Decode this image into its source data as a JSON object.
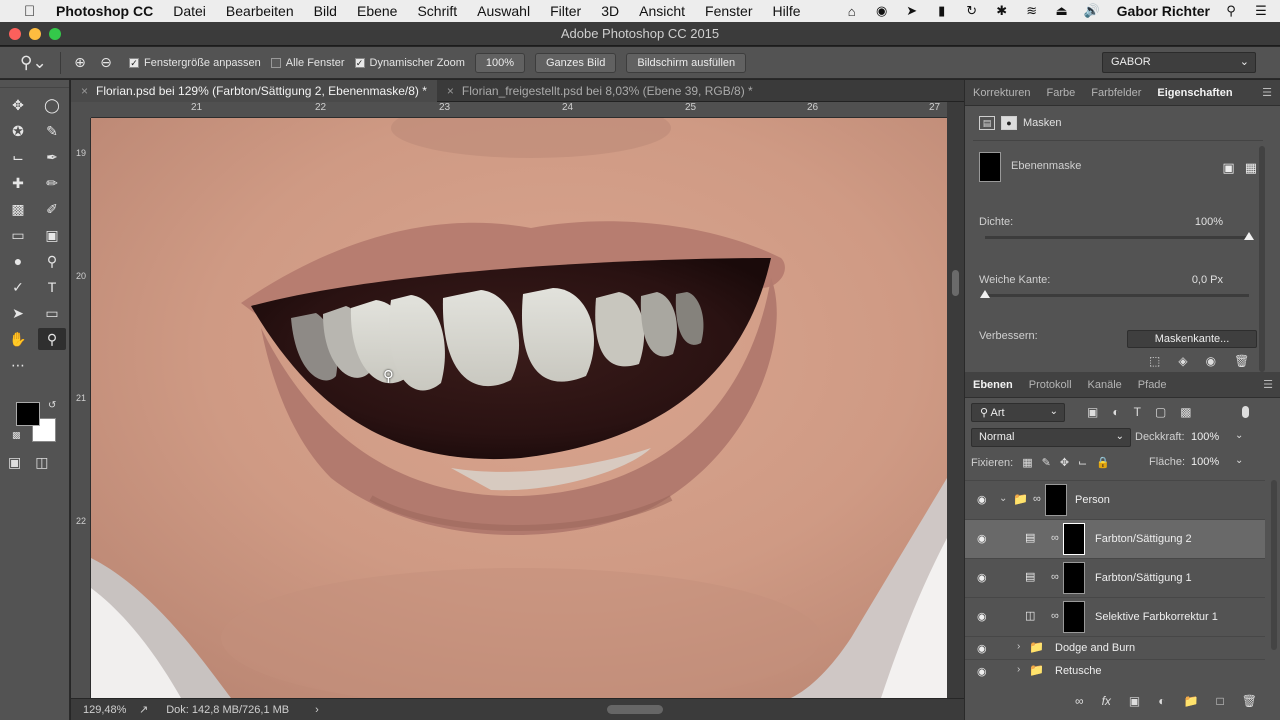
{
  "menubar": {
    "apple": "",
    "items": [
      "Photoshop CC",
      "Datei",
      "Bearbeiten",
      "Bild",
      "Ebene",
      "Schrift",
      "Auswahl",
      "Filter",
      "3D",
      "Ansicht",
      "Fenster",
      "Hilfe"
    ],
    "user": "Gabor Richter"
  },
  "window": {
    "title": "Adobe Photoshop CC 2015"
  },
  "options": {
    "fit_window": "Fenstergröße anpassen",
    "all_windows": "Alle Fenster",
    "dynamic_zoom": "Dynamischer Zoom",
    "zoom_100": "100%",
    "fit_screen": "Ganzes Bild",
    "fill_screen": "Bildschirm ausfüllen",
    "workspace": "GABOR"
  },
  "tabs": [
    {
      "label": "Florian.psd bei 129% (Farbton/Sättigung 2, Ebenenmaske/8) *"
    },
    {
      "label": "Florian_freigestellt.psd bei 8,03% (Ebene 39, RGB/8) *"
    }
  ],
  "ruler": {
    "h": [
      "21",
      "22",
      "23",
      "24",
      "25",
      "26",
      "27"
    ],
    "v": [
      "19",
      "20",
      "21",
      "22"
    ]
  },
  "status": {
    "zoom": "129,48%",
    "doc": "Dok: 142,8 MB/726,1 MB",
    "arrow": "›"
  },
  "panel_tabs": [
    "Korrekturen",
    "Farbe",
    "Farbfelder",
    "Eigenschaften"
  ],
  "properties": {
    "masks": "Masken",
    "layer_mask": "Ebenenmaske",
    "density_label": "Dichte:",
    "density_value": "100%",
    "density": 1.0,
    "feather_label": "Weiche Kante:",
    "feather_value": "0,0 Px",
    "feather": 0.0,
    "refine_label": "Verbessern:",
    "mask_edge": "Maskenkante..."
  },
  "layers_tabs": [
    "Ebenen",
    "Protokoll",
    "Kanäle",
    "Pfade"
  ],
  "layers": {
    "kind": "Art",
    "blend": "Normal",
    "opacity_label": "Deckkraft:",
    "opacity_value": "100%",
    "lock_label": "Fixieren:",
    "fill_label": "Fläche:",
    "fill_value": "100%",
    "items": [
      {
        "name": "Person"
      },
      {
        "name": "Farbton/Sättigung 2"
      },
      {
        "name": "Farbton/Sättigung 1"
      },
      {
        "name": "Selektive Farbkorrektur 1"
      },
      {
        "name": "Dodge and Burn"
      },
      {
        "name": "Retusche"
      }
    ]
  }
}
